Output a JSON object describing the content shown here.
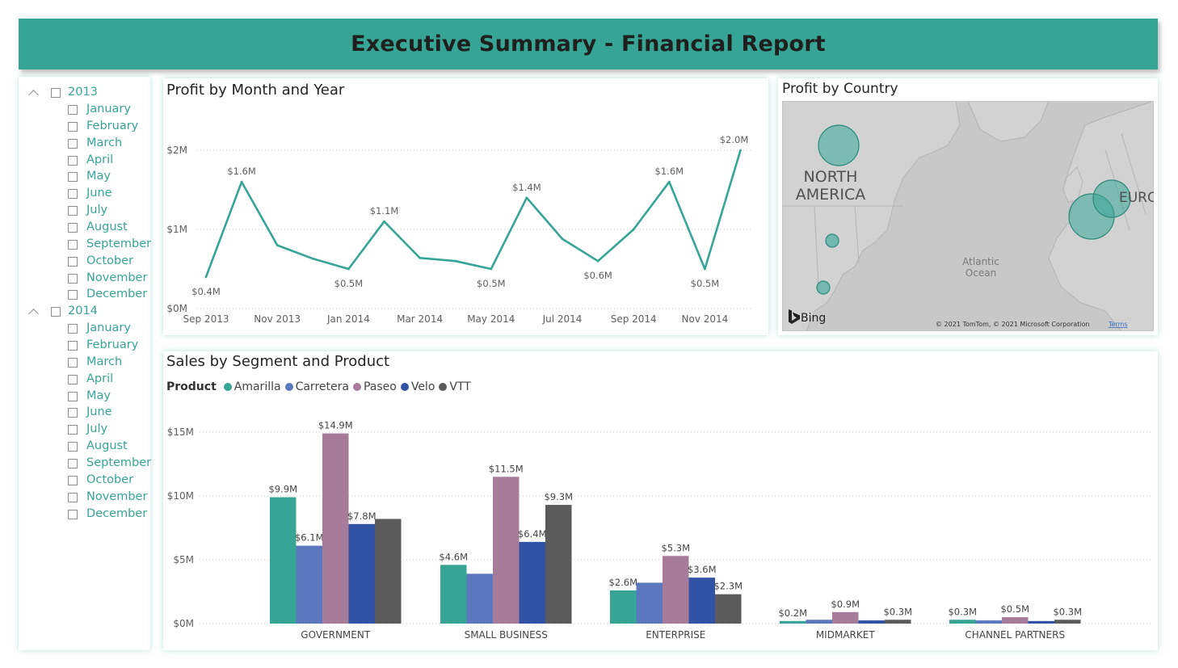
{
  "header": {
    "title": "Executive Summary - Financial Report"
  },
  "slicer": {
    "years": [
      {
        "year": "2013",
        "months": [
          "January",
          "February",
          "March",
          "April",
          "May",
          "June",
          "July",
          "August",
          "September",
          "October",
          "November",
          "December"
        ]
      },
      {
        "year": "2014",
        "months": [
          "January",
          "February",
          "March",
          "April",
          "May",
          "June",
          "July",
          "August",
          "September",
          "October",
          "November",
          "December"
        ]
      }
    ]
  },
  "profit_chart": {
    "title": "Profit by Month and Year",
    "y_ticks": [
      "$0M",
      "$1M",
      "$2M"
    ],
    "x_ticks": [
      "Sep 2013",
      "Nov 2013",
      "Jan 2014",
      "Mar 2014",
      "May 2014",
      "Jul 2014",
      "Sep 2014",
      "Nov 2014"
    ]
  },
  "map": {
    "title": "Profit by Country",
    "labels": {
      "north_america_line1": "NORTH",
      "north_america_line2": "AMERICA",
      "europe": "EURO",
      "ocean_line1": "Atlantic",
      "ocean_line2": "Ocean"
    },
    "bing": "Bing",
    "copyright": "© 2021 TomTom, © 2021 Microsoft Corporation",
    "terms": "Terms",
    "bubble_color": "#36a596"
  },
  "sales_chart": {
    "title": "Sales by Segment and Product",
    "legend_title": "Product",
    "y_ticks": [
      "$0M",
      "$5M",
      "$10M",
      "$15M"
    ]
  },
  "colors": {
    "accent": "#36a596",
    "Amarilla": "#36a596",
    "Carretera": "#5b77bd",
    "Paseo": "#a67c9a",
    "Velo": "#3152a5",
    "VTT": "#5b5b5b"
  },
  "chart_data": [
    {
      "type": "line",
      "title": "Profit by Month and Year",
      "x": [
        "Sep 2013",
        "Oct 2013",
        "Nov 2013",
        "Dec 2013",
        "Jan 2014",
        "Feb 2014",
        "Mar 2014",
        "Apr 2014",
        "May 2014",
        "Jun 2014",
        "Jul 2014",
        "Aug 2014",
        "Sep 2014",
        "Oct 2014",
        "Nov 2014",
        "Dec 2014"
      ],
      "series": [
        {
          "values": [
            0.4,
            1.6,
            0.8,
            0.63,
            0.5,
            1.1,
            0.64,
            0.6,
            0.5,
            1.4,
            0.88,
            0.6,
            1.0,
            1.6,
            0.5,
            2.0
          ]
        }
      ],
      "data_labels": [
        {
          "x": "Sep 2013",
          "label": "$0.4M"
        },
        {
          "x": "Oct 2013",
          "label": "$1.6M"
        },
        {
          "x": "Jan 2014",
          "label": "$0.5M"
        },
        {
          "x": "Feb 2014",
          "label": "$1.1M"
        },
        {
          "x": "May 2014",
          "label": "$0.5M"
        },
        {
          "x": "Jun 2014",
          "label": "$1.4M"
        },
        {
          "x": "Aug 2014",
          "label": "$0.6M"
        },
        {
          "x": "Oct 2014",
          "label": "$1.6M"
        },
        {
          "x": "Nov 2014",
          "label": "$0.5M"
        },
        {
          "x": "Dec 2014",
          "label": "$2.0M"
        }
      ],
      "ylim": [
        0,
        2.1
      ],
      "y_unit": "$M",
      "grid": true
    },
    {
      "type": "bar",
      "title": "Sales by Segment and Product",
      "categories": [
        "GOVERNMENT",
        "SMALL BUSINESS",
        "ENTERPRISE",
        "MIDMARKET",
        "CHANNEL PARTNERS"
      ],
      "series": [
        {
          "name": "Amarilla",
          "values": [
            9.9,
            4.6,
            2.6,
            0.2,
            0.3
          ]
        },
        {
          "name": "Carretera",
          "values": [
            6.1,
            3.9,
            3.2,
            0.3,
            0.25
          ]
        },
        {
          "name": "Paseo",
          "values": [
            14.9,
            11.5,
            5.3,
            0.9,
            0.5
          ]
        },
        {
          "name": "Velo",
          "values": [
            7.8,
            6.4,
            3.6,
            0.25,
            0.2
          ]
        },
        {
          "name": "VTT",
          "values": [
            8.2,
            9.3,
            2.3,
            0.3,
            0.3
          ]
        }
      ],
      "data_labels": [
        [
          "$9.9M",
          "$6.1M",
          "$14.9M",
          "$7.8M",
          ""
        ],
        [
          "$4.6M",
          "",
          "$11.5M",
          "$6.4M",
          "$9.3M"
        ],
        [
          "$2.6M",
          "",
          "$5.3M",
          "$3.6M",
          "$2.3M"
        ],
        [
          "$0.2M",
          "",
          "$0.9M",
          "",
          "$0.3M"
        ],
        [
          "$0.3M",
          "",
          "$0.5M",
          "",
          "$0.3M"
        ]
      ],
      "ylim": [
        0,
        16
      ],
      "y_unit": "$M",
      "legend": "top-left",
      "grid": true
    },
    {
      "type": "scatter",
      "title": "Profit by Country",
      "points": [
        {
          "region": "Canada",
          "size": "large"
        },
        {
          "region": "United States",
          "size": "small"
        },
        {
          "region": "Mexico",
          "size": "small"
        },
        {
          "region": "France",
          "size": "large"
        },
        {
          "region": "Germany",
          "size": "medium"
        }
      ]
    }
  ]
}
